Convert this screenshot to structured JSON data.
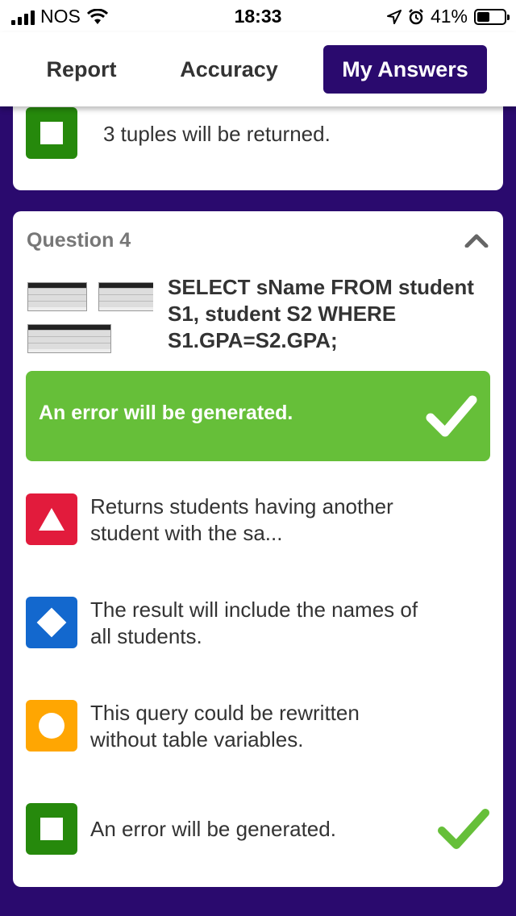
{
  "status_bar": {
    "carrier": "NOS",
    "time": "18:33",
    "battery": "41%"
  },
  "tabs": [
    {
      "label": "Report",
      "active": false
    },
    {
      "label": "Accuracy",
      "active": false
    },
    {
      "label": "My Answers",
      "active": true
    }
  ],
  "previous_card": {
    "answer_text": "3 tuples will be returned.",
    "shape": "square",
    "color": "#26890c"
  },
  "question": {
    "title": "Question 4",
    "text": "SELECT sName FROM student S1, student S2 WHERE S1.GPA=S2.GPA;",
    "thumbnail_icon": "schema-tables-thumbnail",
    "correct_answer_label": "An error will be generated.",
    "correct_color": "#66bf39",
    "answers": [
      {
        "text": "Returns students having another student with the sa...",
        "shape": "triangle",
        "color": "#e21b3c",
        "correct": false
      },
      {
        "text": "The result will include the names of all students.",
        "shape": "diamond",
        "color": "#1368ce",
        "correct": false
      },
      {
        "text": "This query could be rewritten without table variables.",
        "shape": "circle",
        "color": "#ffa602",
        "correct": false
      },
      {
        "text": "An error will be generated.",
        "shape": "square",
        "color": "#26890c",
        "correct": true
      }
    ]
  },
  "colors": {
    "background": "#2a0a6e",
    "active_tab": "#2a0a6e"
  }
}
